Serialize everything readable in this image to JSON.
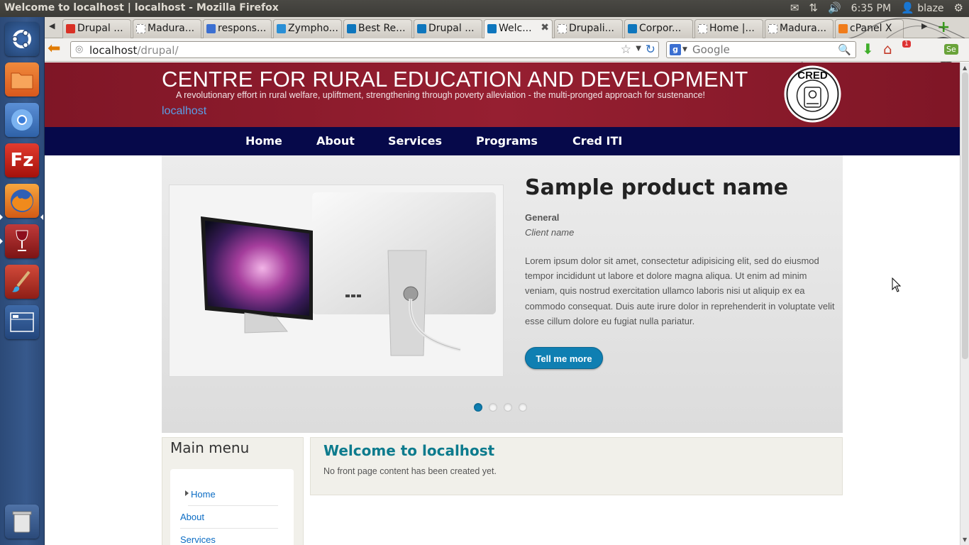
{
  "window": {
    "title": "Welcome to localhost | localhost - Mozilla Firefox",
    "clock": "6:35 PM",
    "user": "blaze"
  },
  "indicators": {
    "icons": [
      "mail-icon",
      "network-icon",
      "volume-icon",
      "user-icon",
      "gear-icon"
    ]
  },
  "launcher": {
    "items": [
      "ubuntu-dash",
      "files",
      "chromium",
      "filezilla",
      "firefox",
      "wine",
      "paint",
      "workspace-switcher",
      "trash"
    ],
    "filezilla_letters": "Fz"
  },
  "tabs": [
    {
      "label": "Drupal ...",
      "favicon": "gmail"
    },
    {
      "label": "Madura...",
      "favicon": "blank"
    },
    {
      "label": "respons...",
      "favicon": "google"
    },
    {
      "label": "Zympho...",
      "favicon": "zymphonies"
    },
    {
      "label": "Best Re...",
      "favicon": "drupal"
    },
    {
      "label": "Drupal ...",
      "favicon": "drupal"
    },
    {
      "label": "Welc...",
      "favicon": "drupal",
      "active": true
    },
    {
      "label": "Drupali...",
      "favicon": "blank"
    },
    {
      "label": "Corpor...",
      "favicon": "drupal"
    },
    {
      "label": "Home |...",
      "favicon": "blank"
    },
    {
      "label": "Madura...",
      "favicon": "blank"
    },
    {
      "label": "cPanel X",
      "favicon": "cpanel"
    }
  ],
  "navbar": {
    "url_host": "localhost",
    "url_path": "/drupal/",
    "search_placeholder": "Google",
    "search_engine_letter": "g",
    "download_badge": "1",
    "addon_label": "Se"
  },
  "site": {
    "title": "CENTRE FOR RURAL EDUCATION AND DEVELOPMENT",
    "slogan": "A revolutionary effort in rural welfare, upliftment, strengthening through poverty alleviation - the multi-pronged approach for sustenance!",
    "site_name": "localhost",
    "logo_text": "CRED"
  },
  "main_nav": [
    "Home",
    "About",
    "Services",
    "Programs",
    "Cred ITI"
  ],
  "slider": {
    "title": "Sample product name",
    "category": "General",
    "client": "Client name",
    "body": "Lorem ipsum dolor sit amet, consectetur adipisicing elit, sed do eiusmod tempor incididunt ut labore et dolore magna aliqua. Ut enim ad minim veniam, quis nostrud exercitation ullamco laboris nisi ut aliquip ex ea commodo consequat. Duis aute irure dolor in reprehenderit in voluptate velit esse cillum dolore eu fugiat nulla pariatur.",
    "button": "Tell me more",
    "dots_total": 4,
    "active_dot": 1
  },
  "sidebar": {
    "title": "Main menu",
    "links": [
      "Home",
      "About",
      "Services"
    ]
  },
  "content": {
    "title": "Welcome to localhost",
    "text": "No front page content has been created yet."
  },
  "colors": {
    "header_red": "#8a1a2a",
    "nav_navy": "#06094a",
    "link_blue": "#0b6cc4",
    "button_blue": "#0f7fb2",
    "content_title_teal": "#0d7b8d"
  }
}
